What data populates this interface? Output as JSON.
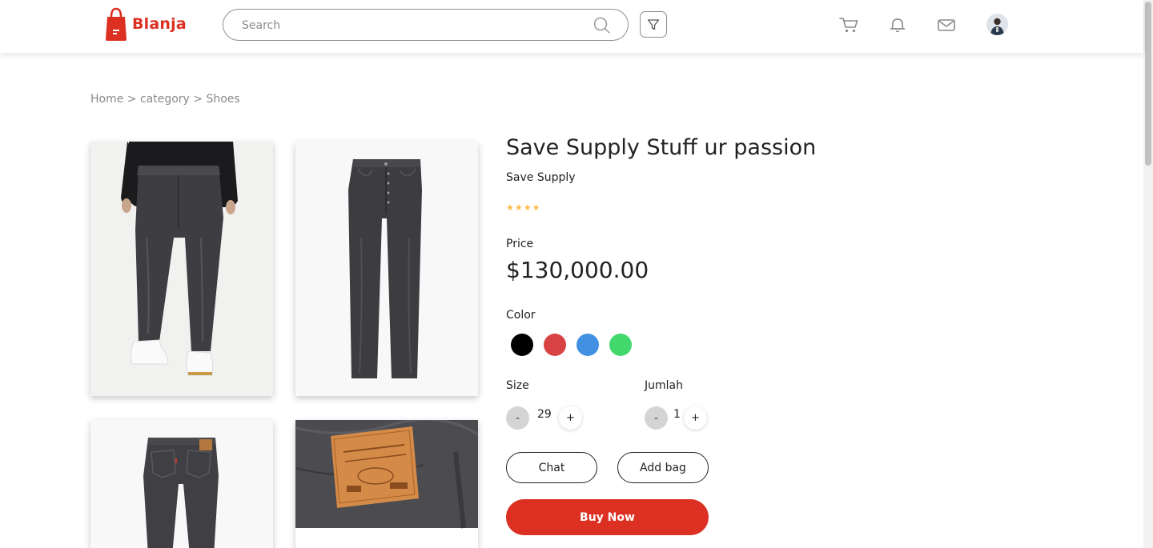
{
  "header": {
    "brand": "Blanja",
    "search_placeholder": "Search",
    "search_value": "",
    "icons": [
      "search-icon",
      "filter-icon",
      "cart-icon",
      "bell-icon",
      "mail-icon",
      "avatar"
    ]
  },
  "breadcrumb": {
    "text": "Home > category > Shoes"
  },
  "product": {
    "title": "Save Supply Stuff ur passion",
    "brand": "Save Supply",
    "rating": 4,
    "rating_max": 5,
    "price_label": "Price",
    "price": "$130,000.00",
    "color_label": "Color",
    "colors": [
      "#000000",
      "#D84242",
      "#4290E1",
      "#42D86C"
    ],
    "size_label": "Size",
    "size_value": "29",
    "quantity_label": "Jumlah",
    "quantity_value": "1",
    "minus_label": "-",
    "plus_label": "+"
  },
  "actions": {
    "chat_label": "Chat",
    "add_bag_label": "Add bag",
    "buy_label": "Buy Now"
  },
  "theme": {
    "accent": "#DB3022",
    "star": "#FFBA49"
  }
}
